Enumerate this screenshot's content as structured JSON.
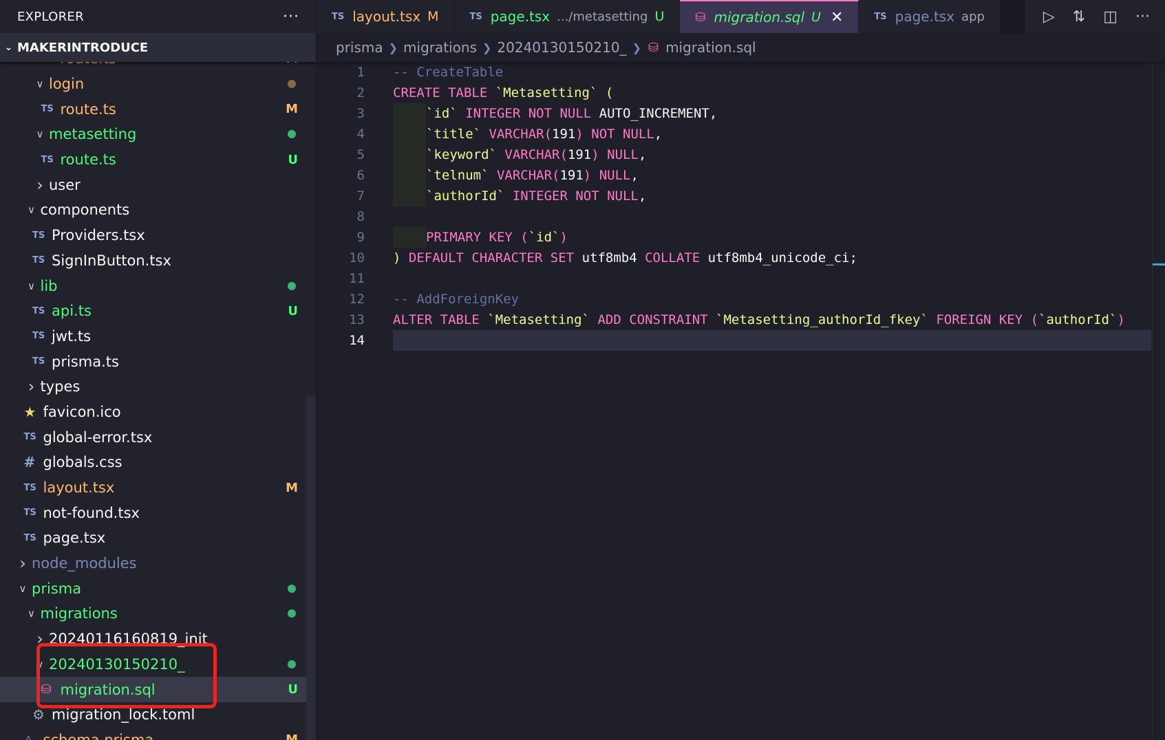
{
  "explorer": {
    "title": "EXPLORER",
    "more": "···",
    "project": "MAKERINTRODUCE",
    "rows": [
      {
        "label": "route.ts",
        "indent": 3,
        "kind": "file",
        "icon": "TS",
        "color": "orange",
        "badge": "M"
      },
      {
        "label": "login",
        "indent": 2,
        "kind": "folder-open",
        "color": "orange",
        "dot": "brown"
      },
      {
        "label": "route.ts",
        "indent": 3,
        "kind": "file",
        "icon": "TS",
        "color": "orange",
        "badge": "M"
      },
      {
        "label": "metasetting",
        "indent": 2,
        "kind": "folder-open",
        "color": "green",
        "dot": "green"
      },
      {
        "label": "route.ts",
        "indent": 3,
        "kind": "file",
        "icon": "TS",
        "color": "green",
        "badge": "U"
      },
      {
        "label": "user",
        "indent": 2,
        "kind": "folder-closed",
        "color": "white"
      },
      {
        "label": "components",
        "indent": 1,
        "kind": "folder-open",
        "color": "white"
      },
      {
        "label": "Providers.tsx",
        "indent": 2,
        "kind": "file",
        "icon": "TS",
        "color": "white"
      },
      {
        "label": "SignInButton.tsx",
        "indent": 2,
        "kind": "file",
        "icon": "TS",
        "color": "white"
      },
      {
        "label": "lib",
        "indent": 1,
        "kind": "folder-open",
        "color": "green",
        "dot": "green"
      },
      {
        "label": "api.ts",
        "indent": 2,
        "kind": "file",
        "icon": "TS",
        "color": "green",
        "badge": "U"
      },
      {
        "label": "jwt.ts",
        "indent": 2,
        "kind": "file",
        "icon": "TS",
        "color": "white"
      },
      {
        "label": "prisma.ts",
        "indent": 2,
        "kind": "file",
        "icon": "TS",
        "color": "white"
      },
      {
        "label": "types",
        "indent": 1,
        "kind": "folder-closed",
        "color": "white"
      },
      {
        "label": "favicon.ico",
        "indent": 1,
        "kind": "file",
        "icon": "star",
        "color": "white"
      },
      {
        "label": "global-error.tsx",
        "indent": 1,
        "kind": "file",
        "icon": "TS",
        "color": "white"
      },
      {
        "label": "globals.css",
        "indent": 1,
        "kind": "file",
        "icon": "hash",
        "color": "white"
      },
      {
        "label": "layout.tsx",
        "indent": 1,
        "kind": "file",
        "icon": "TS",
        "color": "orange",
        "badge": "M"
      },
      {
        "label": "not-found.tsx",
        "indent": 1,
        "kind": "file",
        "icon": "TS",
        "color": "white"
      },
      {
        "label": "page.tsx",
        "indent": 1,
        "kind": "file",
        "icon": "TS",
        "color": "white"
      },
      {
        "label": "node_modules",
        "indent": 0,
        "kind": "folder-closed",
        "color": "muted"
      },
      {
        "label": "prisma",
        "indent": 0,
        "kind": "folder-open",
        "color": "green",
        "dot": "green"
      },
      {
        "label": "migrations",
        "indent": 1,
        "kind": "folder-open",
        "color": "green",
        "dot": "green"
      },
      {
        "label": "20240116160819_init",
        "indent": 2,
        "kind": "folder-closed",
        "color": "white"
      },
      {
        "label": "20240130150210_",
        "indent": 2,
        "kind": "folder-open",
        "color": "green",
        "dot": "green"
      },
      {
        "label": "migration.sql",
        "indent": 3,
        "kind": "file",
        "icon": "db",
        "color": "green",
        "badge": "U",
        "selected": true
      },
      {
        "label": "migration_lock.toml",
        "indent": 2,
        "kind": "file",
        "icon": "gear",
        "color": "white"
      },
      {
        "label": "schema.prisma",
        "indent": 1,
        "kind": "file",
        "icon": "prism",
        "color": "orange",
        "badge": "M"
      }
    ]
  },
  "tabs": [
    {
      "label": "layout.tsx",
      "desc": "",
      "status": "M",
      "status_color": "#ffb86c",
      "label_color": "#ffb86c",
      "icon": "TS"
    },
    {
      "label": "page.tsx",
      "desc": ".../metasetting",
      "status": "U",
      "status_color": "#50fa7b",
      "label_color": "#50fa7b",
      "icon": "TS"
    },
    {
      "label": "migration.sql",
      "desc": "",
      "status": "U",
      "status_color": "#50fa7b",
      "label_color": "#50fa7b",
      "icon": "db",
      "active": true
    },
    {
      "label": "page.tsx",
      "desc": "app",
      "status": "",
      "label_color": "#7b88b8",
      "icon": "TS"
    }
  ],
  "tab_actions": [
    "run-icon",
    "compare-changes-icon",
    "split-editor-icon",
    "more-actions-icon"
  ],
  "breadcrumb": [
    "prisma",
    "migrations",
    "20240130150210_",
    "migration.sql"
  ],
  "editor": {
    "current_line": 14,
    "lines": [
      [
        {
          "t": "-- CreateTable",
          "c": "cm"
        }
      ],
      [
        {
          "t": "CREATE TABLE ",
          "c": "k"
        },
        {
          "t": "`Metasetting`",
          "c": "bt"
        },
        {
          "t": " ",
          "c": "p"
        },
        {
          "t": "(",
          "c": "paren"
        }
      ],
      [
        {
          "i": true
        },
        {
          "t": "`id`",
          "c": "bt"
        },
        {
          "t": " INTEGER NOT NULL ",
          "c": "k"
        },
        {
          "t": "AUTO_INCREMENT,",
          "c": "p"
        }
      ],
      [
        {
          "i": true
        },
        {
          "t": "`title`",
          "c": "bt"
        },
        {
          "t": " VARCHAR(",
          "c": "k"
        },
        {
          "t": "191",
          "c": "p"
        },
        {
          "t": ")",
          "c": "k"
        },
        {
          "t": " NOT NULL",
          "c": "k"
        },
        {
          "t": ",",
          "c": "p"
        }
      ],
      [
        {
          "i": true
        },
        {
          "t": "`keyword`",
          "c": "bt"
        },
        {
          "t": " VARCHAR(",
          "c": "k"
        },
        {
          "t": "191",
          "c": "p"
        },
        {
          "t": ")",
          "c": "k"
        },
        {
          "t": " NULL",
          "c": "k"
        },
        {
          "t": ",",
          "c": "p"
        }
      ],
      [
        {
          "i": true
        },
        {
          "t": "`telnum`",
          "c": "bt"
        },
        {
          "t": " VARCHAR(",
          "c": "k"
        },
        {
          "t": "191",
          "c": "p"
        },
        {
          "t": ")",
          "c": "k"
        },
        {
          "t": " NULL",
          "c": "k"
        },
        {
          "t": ",",
          "c": "p"
        }
      ],
      [
        {
          "i": true
        },
        {
          "t": "`authorId`",
          "c": "bt"
        },
        {
          "t": " INTEGER NOT NULL",
          "c": "k"
        },
        {
          "t": ",",
          "c": "p"
        }
      ],
      [],
      [
        {
          "i": true
        },
        {
          "t": "PRIMARY KEY (",
          "c": "k"
        },
        {
          "t": "`id`",
          "c": "bt"
        },
        {
          "t": ")",
          "c": "k"
        }
      ],
      [
        {
          "t": ")",
          "c": "paren"
        },
        {
          "t": " DEFAULT CHARACTER SET ",
          "c": "k"
        },
        {
          "t": "utf8mb4 ",
          "c": "p"
        },
        {
          "t": "COLLATE ",
          "c": "k"
        },
        {
          "t": "utf8mb4_unicode_ci;",
          "c": "p"
        }
      ],
      [],
      [
        {
          "t": "-- AddForeignKey",
          "c": "cm"
        }
      ],
      [
        {
          "t": "ALTER TABLE ",
          "c": "k"
        },
        {
          "t": "`Metasetting`",
          "c": "bt"
        },
        {
          "t": " ADD CONSTRAINT ",
          "c": "k"
        },
        {
          "t": "`Metasetting_authorId_fkey`",
          "c": "bt"
        },
        {
          "t": " FOREIGN KEY (",
          "c": "k"
        },
        {
          "t": "`authorId`",
          "c": "bt"
        },
        {
          "t": ")",
          "c": "k"
        }
      ],
      []
    ]
  },
  "colors": {
    "accent": "#ff79c6",
    "modified": "#ffb86c",
    "untracked": "#50fa7b",
    "annotation": "#e8251f"
  }
}
